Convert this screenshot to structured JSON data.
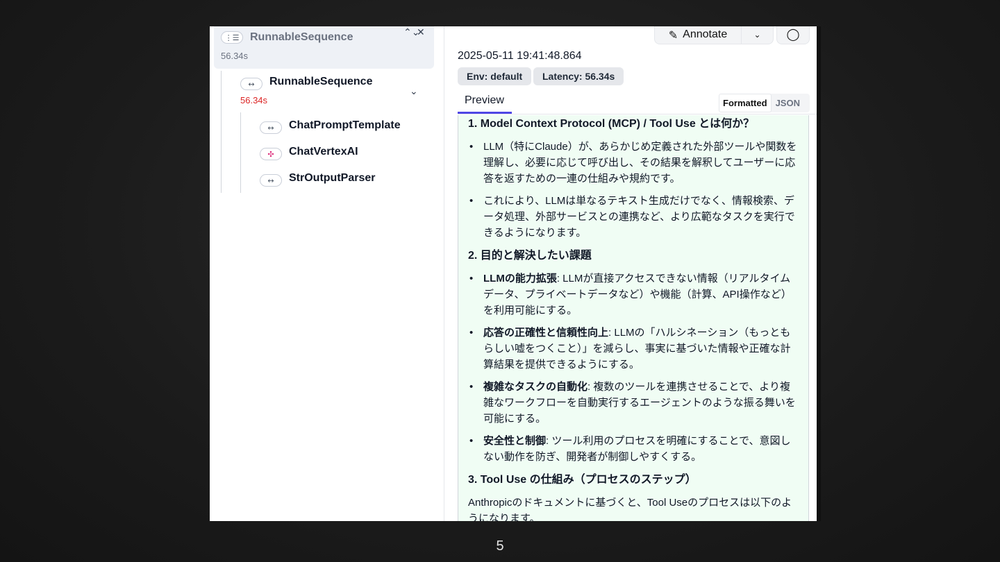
{
  "tree": {
    "root": {
      "icon": "list-tree-icon",
      "label": "RunnableSequence",
      "time": "56.34s"
    },
    "child": {
      "icon": "arrows-icon",
      "label": "RunnableSequence",
      "time": "56.34s"
    },
    "leaves": [
      {
        "icon": "arrows-icon",
        "label": "ChatPromptTemplate"
      },
      {
        "icon": "model-icon",
        "label": "ChatVertexAI"
      },
      {
        "icon": "arrows-icon",
        "label": "StrOutputParser"
      }
    ]
  },
  "toolbar": {
    "annotate_label": "Annotate"
  },
  "run": {
    "timestamp": "2025-05-11 19:41:48.864",
    "env_tag": "Env: default",
    "latency_tag": "Latency: 56.34s"
  },
  "tabs": {
    "preview": "Preview",
    "formatted": "Formatted",
    "json": "JSON"
  },
  "content": {
    "h1": "1. Model Context Protocol (MCP) / Tool Use とは何か？",
    "s1": [
      "LLM（特にClaude）が、あらかじめ定義された外部ツールや関数を理解し、必要に応じて呼び出し、その結果を解釈してユーザーに応答を返すための一連の仕組みや規約です。",
      "これにより、LLMは単なるテキスト生成だけでなく、情報検索、データ処理、外部サービスとの連携など、より広範なタスクを実行できるようになります。"
    ],
    "h2": "2. 目的と解決したい課題",
    "s2": [
      {
        "b": "LLMの能力拡張",
        "t": ": LLMが直接アクセスできない情報（リアルタイムデータ、プライベートデータなど）や機能（計算、API操作など）を利用可能にする。"
      },
      {
        "b": "応答の正確性と信頼性向上",
        "t": ": LLMの「ハルシネーション（もっともらしい嘘をつくこと）」を減らし、事実に基づいた情報や正確な計算結果を提供できるようにする。"
      },
      {
        "b": "複雑なタスクの自動化",
        "t": ": 複数のツールを連携させることで、より複雑なワークフローを自動実行するエージェントのような振る舞いを可能にする。"
      },
      {
        "b": "安全性と制御",
        "t": ": ツール利用のプロセスを明確にすることで、意図しない動作を防ぎ、開発者が制御しやすくする。"
      }
    ],
    "h3": "3. Tool Use の仕組み（プロセスのステップ）",
    "p3": "Anthropicのドキュメントに基づくと、Tool Useのプロセスは以下のようになります。"
  },
  "page_number": "5"
}
